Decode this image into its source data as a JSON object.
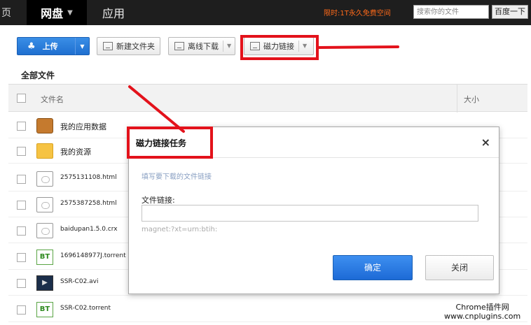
{
  "nav": {
    "edge_char": "页",
    "netdisk": "网盘",
    "apps": "应用",
    "promo": "限时:1T永久免费空间",
    "search_placeholder": "搜索你的文件",
    "search_button": "百度一下"
  },
  "toolbar": {
    "upload": "上传",
    "new_folder": "新建文件夹",
    "offline_download": "离线下载",
    "magnet_link": "磁力链接"
  },
  "section_title": "全部文件",
  "table": {
    "col_name": "文件名",
    "col_size": "大小",
    "rows": [
      {
        "name": "我的应用数据",
        "icon": "briefcase-icon"
      },
      {
        "name": "我的资源",
        "icon": "folder-icon"
      },
      {
        "name": "2575131108.html",
        "icon": "document-icon"
      },
      {
        "name": "2575387258.html",
        "icon": "document-icon"
      },
      {
        "name": "baidupan1.5.0.crx",
        "icon": "document-icon"
      },
      {
        "name": "1696148977J.torrent",
        "icon": "bittorrent-icon"
      },
      {
        "name": "SSR-C02.avi",
        "icon": "video-icon"
      },
      {
        "name": "SSR-C02.torrent",
        "icon": "bittorrent-icon"
      }
    ]
  },
  "dialog": {
    "title": "磁力链接任务",
    "close": "×",
    "hint": "填写要下载的文件链接",
    "label": "文件链接:",
    "input_value": "",
    "example": "magnet:?xt=urn:btih:",
    "ok": "确定",
    "cancel": "关闭"
  },
  "watermark": {
    "line1": "Chrome插件网",
    "line2": "www.cnplugins.com"
  },
  "colors": {
    "annotation_red": "#e3121b",
    "primary_blue": "#1f6fd0",
    "promo_orange": "#ff6a1a"
  }
}
